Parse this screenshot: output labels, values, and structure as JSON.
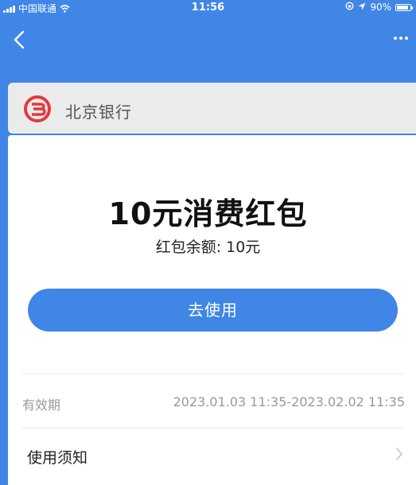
{
  "status_bar": {
    "carrier": "中国联通",
    "time": "11:56",
    "battery": "90%",
    "battery_level": 0.9
  },
  "nav": {
    "back_icon": "chevron-left-icon",
    "more_icon": "ellipsis-icon"
  },
  "bank": {
    "name": "北京银行",
    "logo_icon": "bank-logo-icon",
    "brand_color": "#e4393c"
  },
  "coupon": {
    "title": "10元消费红包",
    "balance_text": "红包余额: 10元",
    "use_button_label": "去使用",
    "validity_label": "有效期",
    "validity_value": "2023.01.03 11:35-2023.02.02 11:35",
    "notice_label": "使用须知"
  },
  "colors": {
    "accent": "#3f86e6",
    "card_header_bg": "#ebebeb",
    "muted_text": "#999999"
  }
}
